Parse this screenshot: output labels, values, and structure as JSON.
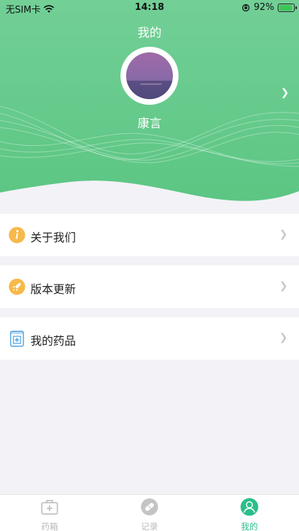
{
  "status_bar": {
    "carrier": "无SIM卡",
    "time": "14:18",
    "battery_percent": "92%",
    "battery_level": 0.92
  },
  "profile": {
    "title": "我的",
    "username": "康言"
  },
  "menu": {
    "items": [
      {
        "label": "关于我们",
        "icon": "info-icon"
      },
      {
        "label": "版本更新",
        "icon": "rocket-icon"
      },
      {
        "label": "我的药品",
        "icon": "medicine-box-icon"
      }
    ]
  },
  "tabbar": {
    "tabs": [
      {
        "label": "药箱",
        "icon": "medicine-kit-icon",
        "active": false
      },
      {
        "label": "记录",
        "icon": "pill-icon",
        "active": false
      },
      {
        "label": "我的",
        "icon": "person-icon",
        "active": true
      }
    ]
  },
  "colors": {
    "header_green": "#62c98a",
    "accent": "#2bbf8a",
    "icon_orange": "#f7b94a",
    "tab_inactive": "#b8b8b8"
  }
}
